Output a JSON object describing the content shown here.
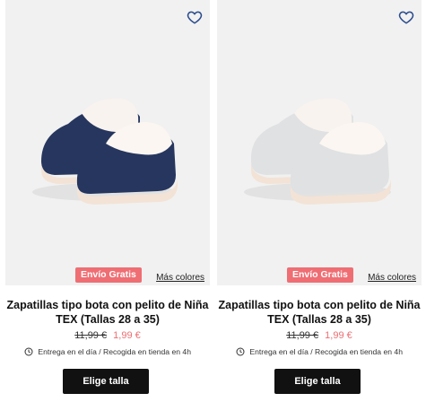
{
  "colors": {
    "badge": "#ee6e73",
    "sale_price": "#ee6e73",
    "button": "#111111",
    "image_bg": "#f1f1f1"
  },
  "products": [
    {
      "title": "Zapatillas tipo bota con pelito de Niña TEX (Tallas 28 a 35)",
      "old_price": "11,99 €",
      "new_price": "1,99 €",
      "badge": "Envío Gratis",
      "more_colors": "Más colores",
      "delivery": "Entrega en el día / Recogida en tienda en 4h",
      "button": "Elige talla",
      "shoe_color": "navy",
      "icon": "heart-icon"
    },
    {
      "title": "Zapatillas tipo bota con pelito de Niña TEX (Tallas 28 a 35)",
      "old_price": "11,99 €",
      "new_price": "1,99 €",
      "badge": "Envío Gratis",
      "more_colors": "Más colores",
      "delivery": "Entrega en el día / Recogida en tienda en 4h",
      "button": "Elige talla",
      "shoe_color": "light-grey",
      "icon": "heart-icon"
    }
  ]
}
